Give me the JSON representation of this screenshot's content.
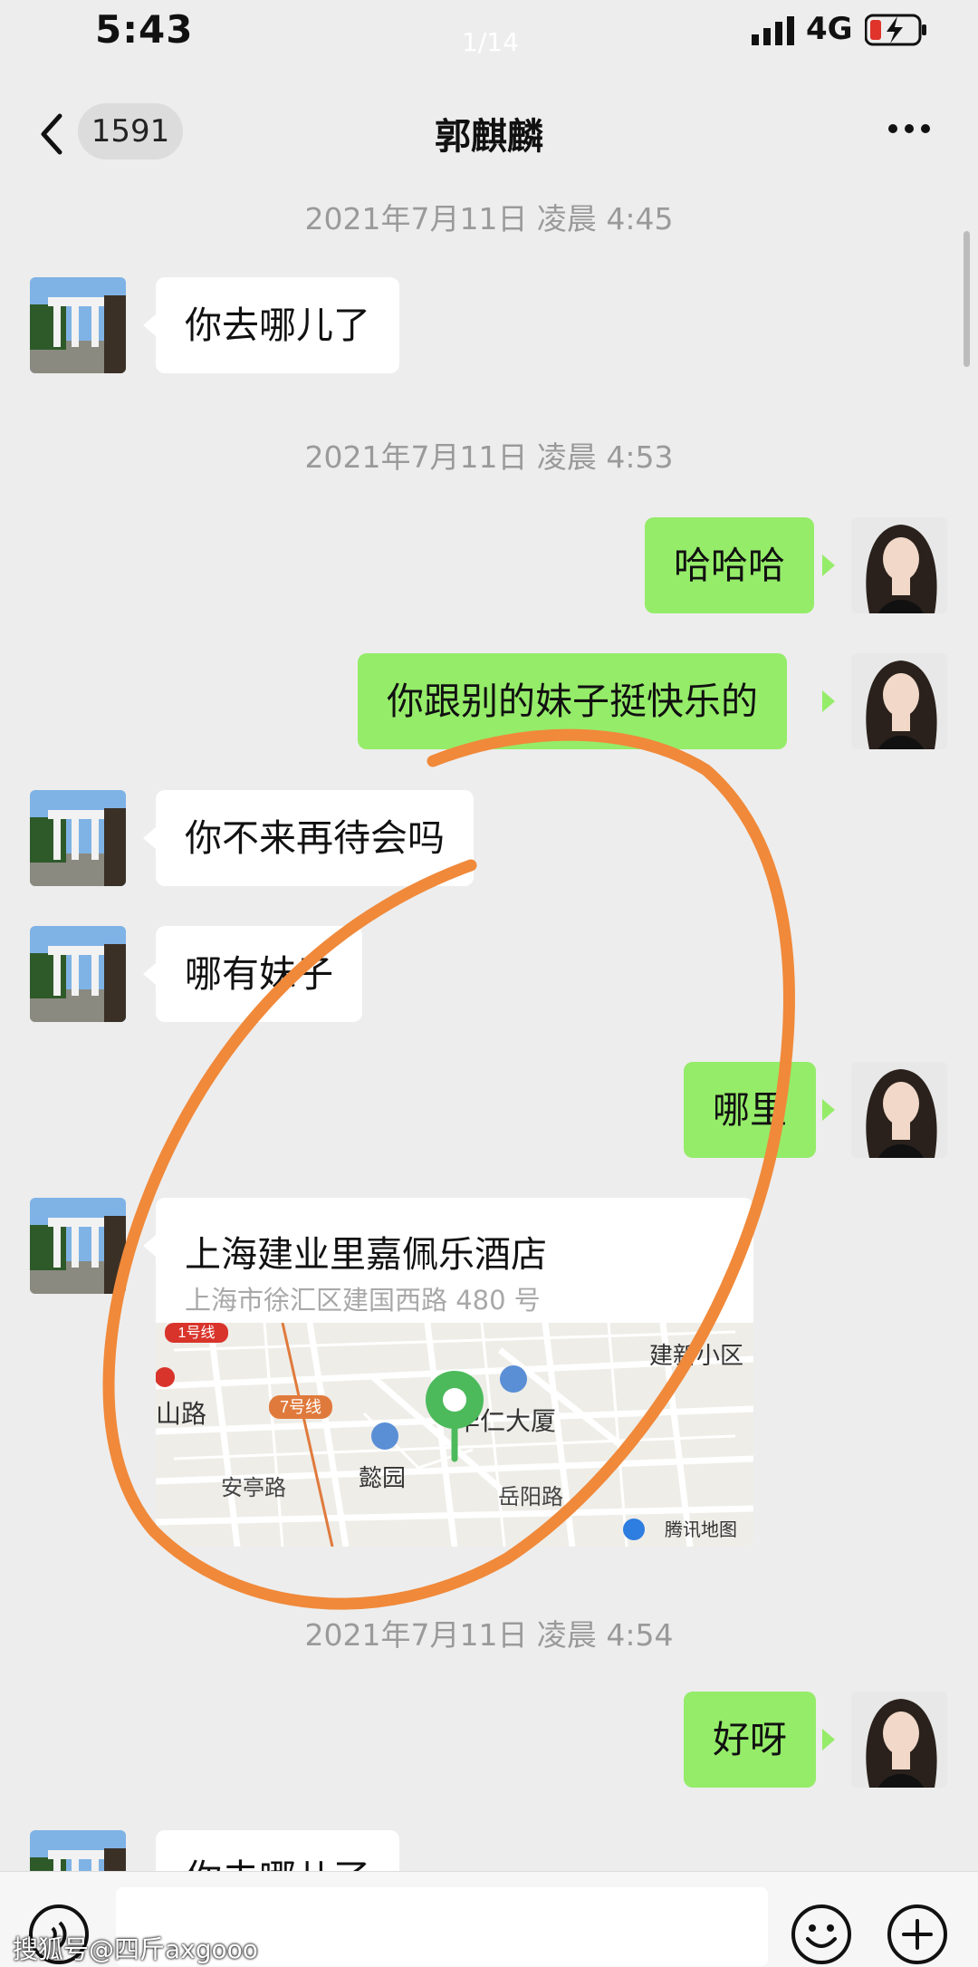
{
  "status_bar": {
    "time": "5:43",
    "network": "4G",
    "pager": "1/14"
  },
  "nav": {
    "back_count": "1591",
    "title": "郭麒麟"
  },
  "timestamps": [
    "2021年7月11日 凌晨 4:45",
    "2021年7月11日 凌晨 4:53",
    "2021年7月11日 凌晨 4:54"
  ],
  "messages": [
    {
      "side": "in",
      "text": "你去哪儿了"
    },
    {
      "side": "out",
      "text": "哈哈哈"
    },
    {
      "side": "out",
      "text": "你跟别的妹子挺快乐的"
    },
    {
      "side": "in",
      "text": "你不来再待会吗"
    },
    {
      "side": "in",
      "text": "哪有妹子"
    },
    {
      "side": "out",
      "text": "哪里"
    },
    {
      "side": "out",
      "text": "好呀"
    },
    {
      "side": "in",
      "text": "你去哪儿了"
    }
  ],
  "location": {
    "name": "上海建业里嘉佩乐酒店",
    "address": "上海市徐汇区建国西路 480 号",
    "map_labels": {
      "line1": "1号线",
      "line7": "7号线",
      "road_left": "山路",
      "district": "建新小区",
      "building": "华仁大厦",
      "park": "懿园",
      "road_an": "安亭路",
      "road_yue": "岳阳路",
      "provider": "腾讯地图"
    }
  },
  "watermark": "搜狐号@四斤axgooo",
  "colors": {
    "outgoing_bubble": "#95ec69",
    "incoming_bubble": "#ffffff",
    "background": "#ededed",
    "annotation_circle": "#f0893a",
    "map_pin": "#4cba5b"
  }
}
